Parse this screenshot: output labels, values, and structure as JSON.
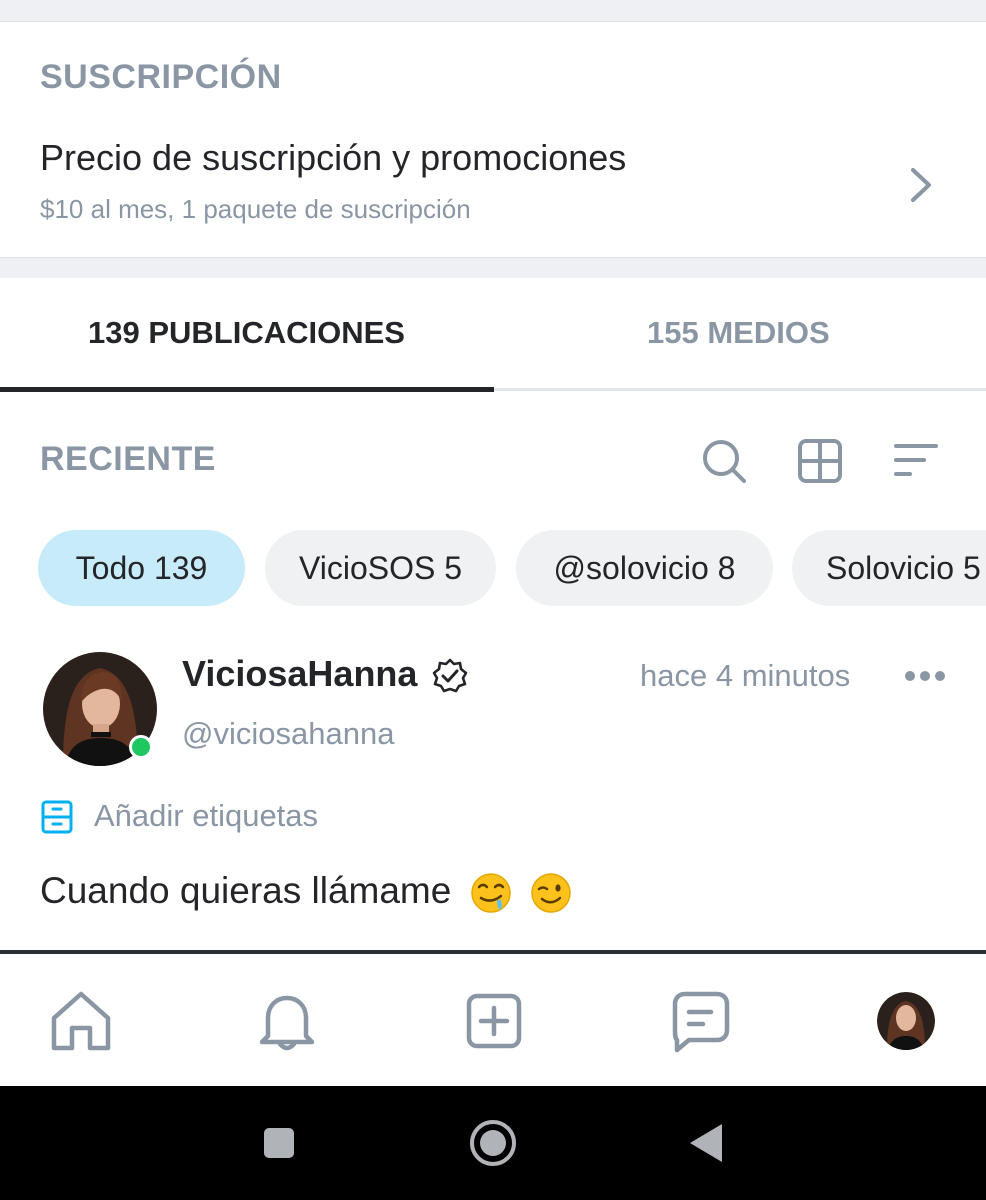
{
  "subscription": {
    "section_title": "SUSCRIPCIÓN",
    "title": "Precio de suscripción y promociones",
    "description": "$10 al mes, 1 paquete de suscripción"
  },
  "tabs": [
    {
      "label": "139 PUBLICACIONES",
      "active": true
    },
    {
      "label": "155 MEDIOS",
      "active": false
    }
  ],
  "feed": {
    "section_title": "RECIENTE",
    "tool_icons": [
      "search-icon",
      "grid-icon",
      "sort-icon"
    ],
    "filters": [
      {
        "label": "Todo 139",
        "active": true
      },
      {
        "label": "VicioSOS 5",
        "active": false
      },
      {
        "label": "@solovicio 8",
        "active": false
      },
      {
        "label": "Solovicio 5",
        "active": false
      }
    ]
  },
  "post": {
    "author_name": "ViciosaHanna",
    "author_handle": "@viciosahanna",
    "time": "hace 4 minutos",
    "verified": true,
    "online": true,
    "tags_label": "Añadir etiquetas",
    "text": "Cuando quieras llámame"
  },
  "bottom_nav": [
    "home-icon",
    "bell-icon",
    "add-post-icon",
    "messages-icon",
    "profile-avatar"
  ],
  "colors": {
    "text_primary": "#242529",
    "text_secondary": "#8a96a3",
    "active_chip": "#c8ebfa",
    "chip": "#f0f1f3",
    "online": "#1ec761",
    "accent": "#00aff0"
  }
}
